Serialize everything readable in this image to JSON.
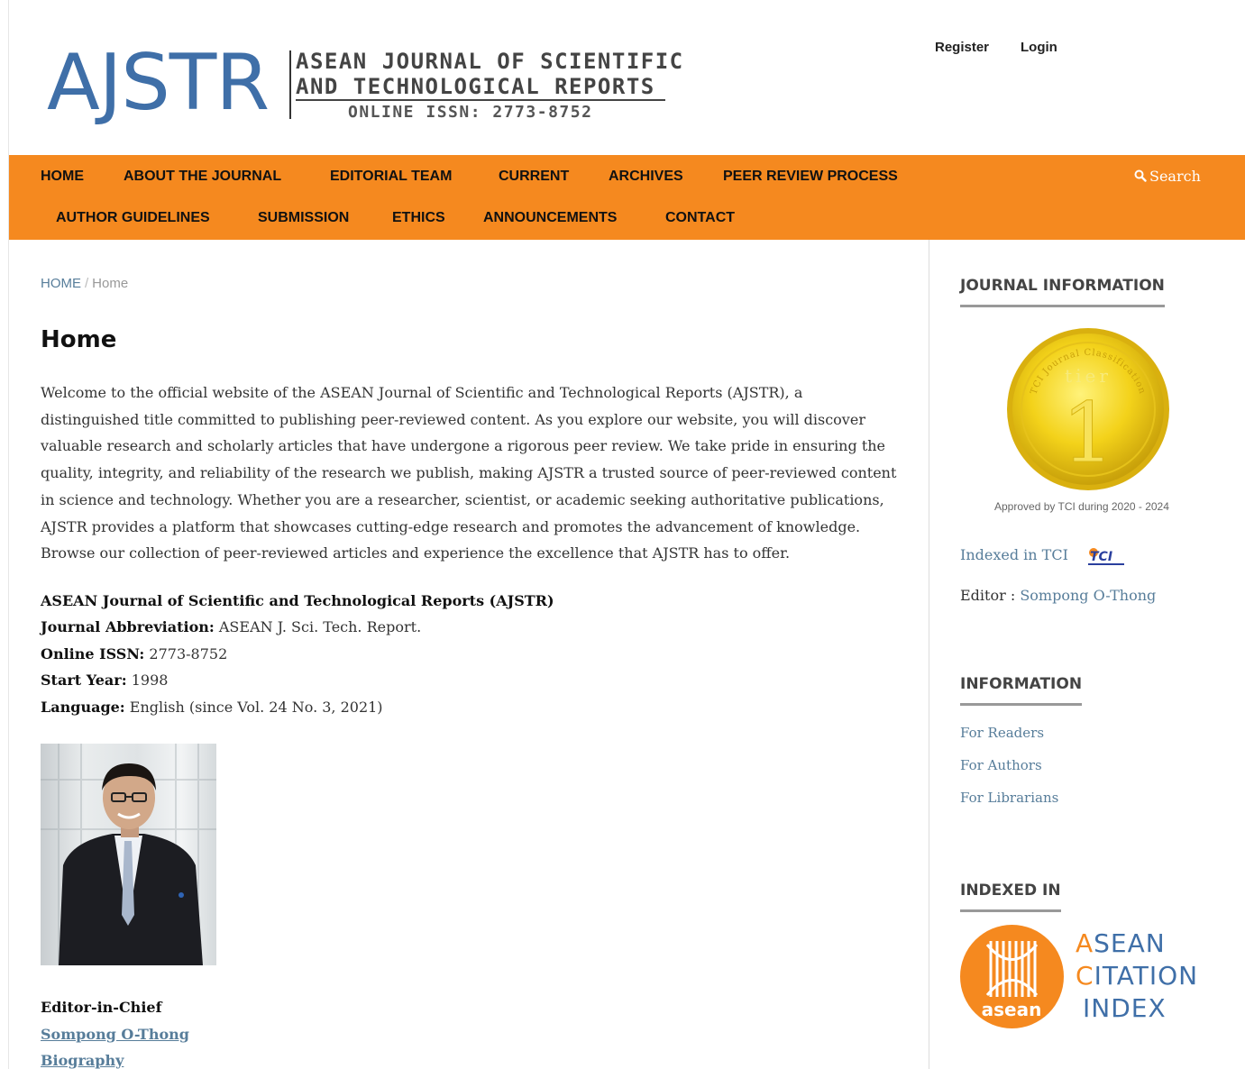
{
  "logo": {
    "big": "AJSTR",
    "line1": "ASEAN JOURNAL OF SCIENTIFIC",
    "line2": "AND TECHNOLOGICAL REPORTS",
    "issn": "ONLINE ISSN: 2773-8752"
  },
  "user_nav": {
    "register": "Register",
    "login": "Login"
  },
  "nav": {
    "row1": [
      "HOME",
      "ABOUT THE JOURNAL",
      "EDITORIAL TEAM",
      "CURRENT",
      "ARCHIVES",
      "PEER REVIEW PROCESS"
    ],
    "row2": [
      "AUTHOR GUIDELINES",
      "SUBMISSION",
      "ETHICS",
      "ANNOUNCEMENTS",
      "CONTACT"
    ],
    "search": "Search"
  },
  "breadcrumb": {
    "home": "HOME",
    "sep": "/",
    "current": "Home"
  },
  "page_title": "Home",
  "intro": "Welcome to the official website of the ASEAN Journal of Scientific and Technological Reports (AJSTR), a distinguished title committed to publishing peer-reviewed content. As you explore our website, you will discover valuable research and scholarly articles that have undergone a rigorous peer review. We take pride in ensuring the quality, integrity, and reliability of the research we publish, making AJSTR a trusted source of peer-reviewed content in science and technology. Whether you are a researcher, scientist, or academic seeking authoritative publications, AJSTR provides a platform that showcases cutting-edge research and promotes the advancement of knowledge. Browse our collection of peer-reviewed articles and experience the excellence that AJSTR has to offer.",
  "facts": {
    "journal_name": "ASEAN Journal of Scientific and Technological Reports (AJSTR)",
    "abbrev_label": "Journal Abbreviation:",
    "abbrev_value": " ASEAN J. Sci. Tech. Report.",
    "issn_label": "Online ISSN:",
    "issn_value": " 2773-8752",
    "start_label": "Start Year:",
    "start_value": " 1998",
    "lang_label": "Language:",
    "lang_value": " English (since Vol. 24 No. 3, 2021)"
  },
  "editor_in_chief": {
    "label": "Editor-in-Chief",
    "name": "Sompong O-Thong",
    "bio": "Biography"
  },
  "sidebar": {
    "journal_info_heading": "JOURNAL INFORMATION",
    "medal_top_text": "TCI Journal Classification",
    "medal_tier": "tier",
    "medal_number": "1",
    "medal_caption": "Approved by TCI during 2020 - 2024",
    "indexed_tci": "Indexed in TCI",
    "tci_logo_text": "TCI",
    "editor_label": "Editor : ",
    "editor_name": "Sompong O-Thong",
    "information_heading": "INFORMATION",
    "info_links": [
      "For Readers",
      "For Authors",
      "For Librarians"
    ],
    "indexed_heading": "INDEXED IN",
    "aci_circle_text": "asean",
    "aci_line1_first": "A",
    "aci_line1_rest": "SEAN",
    "aci_line2_first": "C",
    "aci_line2_rest": "ITATION",
    "aci_line3": "INDEX"
  },
  "colors": {
    "nav_orange": "#f5891f",
    "link_blue": "#577d9a",
    "logo_blue": "#3f6fa8",
    "medal_gold": "#f3d21a"
  }
}
